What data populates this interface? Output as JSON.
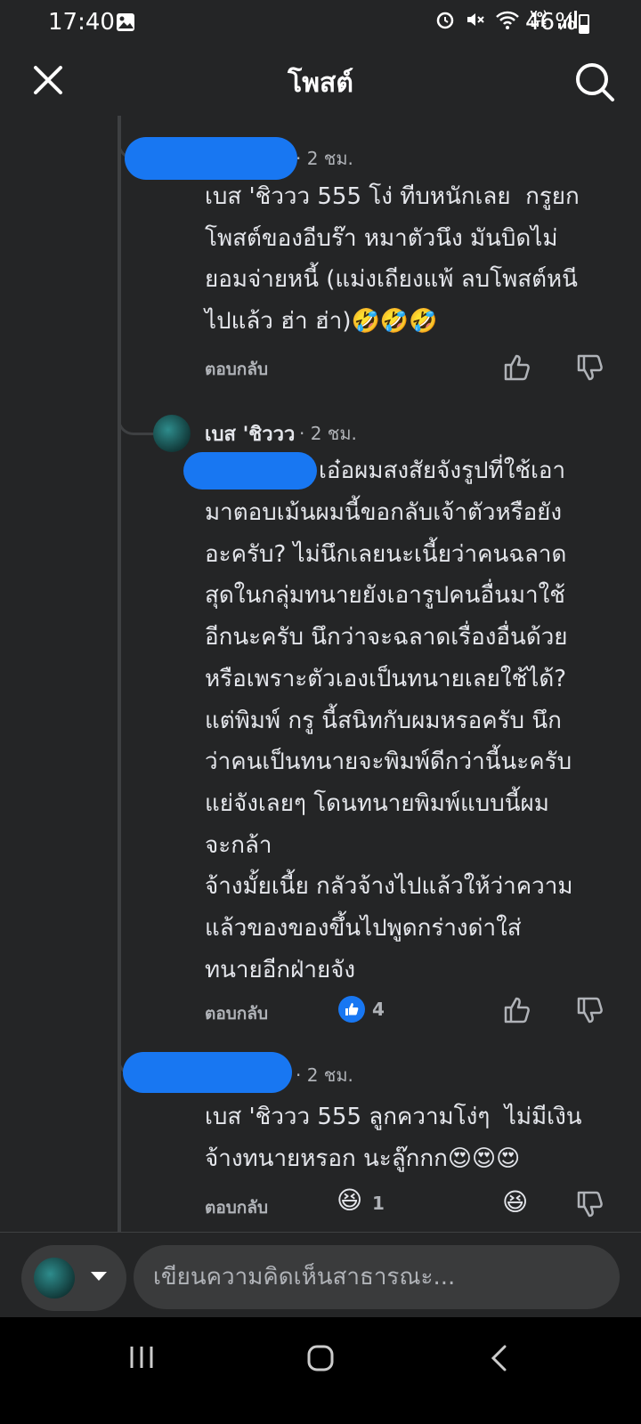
{
  "status_bar": {
    "time": "17:40",
    "battery": "46%",
    "battery_level": 0.46,
    "net_label": "Vo) LTE"
  },
  "header": {
    "title": "โพสต์"
  },
  "comments": [
    {
      "time": "· 2 ชม.",
      "text": "เบส 'ชิววว 555 โง่ ทีบหนักเลย  กรูยก\nโพสต์ของอีบร๊า หมาตัวนึง มันบิดไม่\nยอมจ่ายหนี้ (แม่งเถียงแพ้ ลบโพสต์หนี\nไปแล้ว ฮ่า ฮ่า)",
      "emojis": "🤣🤣🤣",
      "reply": "ตอบกลับ"
    },
    {
      "name": "เบส 'ชิววว",
      "time": "· 2 ชม.",
      "text_first": "เอ๋อผมสงสัยจังรูปที่ใช้เอา",
      "text": "มาตอบเม้นผมนี้ขอกลับเจ้าตัวหรือยัง\nอะครับ? ไม่นึกเลยนะเนี้ยว่าคนฉลาด\nสุดในกลุ่มทนายยังเอารูปคนอื่นมาใช้\nอีกนะครับ นึกว่าจะฉลาดเรื่องอื่นด้วย\nหรือเพราะตัวเองเป็นทนายเลยใช้ได้?\nแต่พิมพ์ กรู นี้สนิทกับผมหรอครับ นึก\nว่าคนเป็นทนายจะพิมพ์ดีกว่านี้นะครับ\nแย่จังเลยๆ โดนทนายพิมพ์แบบนี้ผม\nจะกล้า\nจ้างมั้ยเนี้ย กลัวจ้างไปแล้วให้ว่าความ\nแล้วของของขึ้นไปพูดกร่างด่าใส่\nทนายอีกฝ่ายจัง",
      "reply": "ตอบกลับ",
      "like_count": "4"
    },
    {
      "time": "· 2 ชม.",
      "text": "เบส 'ชิววว 555 ลูกความโง่ๆ  ไม่มีเงิน\nจ้างทนายหรอก นะลู๊กกก",
      "emojis": "😍😍😍",
      "reply": "ตอบกลับ",
      "react_count": "1",
      "react_emoji": "😆"
    }
  ],
  "composer": {
    "placeholder": "เขียนความคิดเห็นสาธารณะ..."
  },
  "colors": {
    "background": "#242526",
    "accent": "#1877f2",
    "text": "#e4e6eb",
    "muted": "#b0b3b8"
  }
}
